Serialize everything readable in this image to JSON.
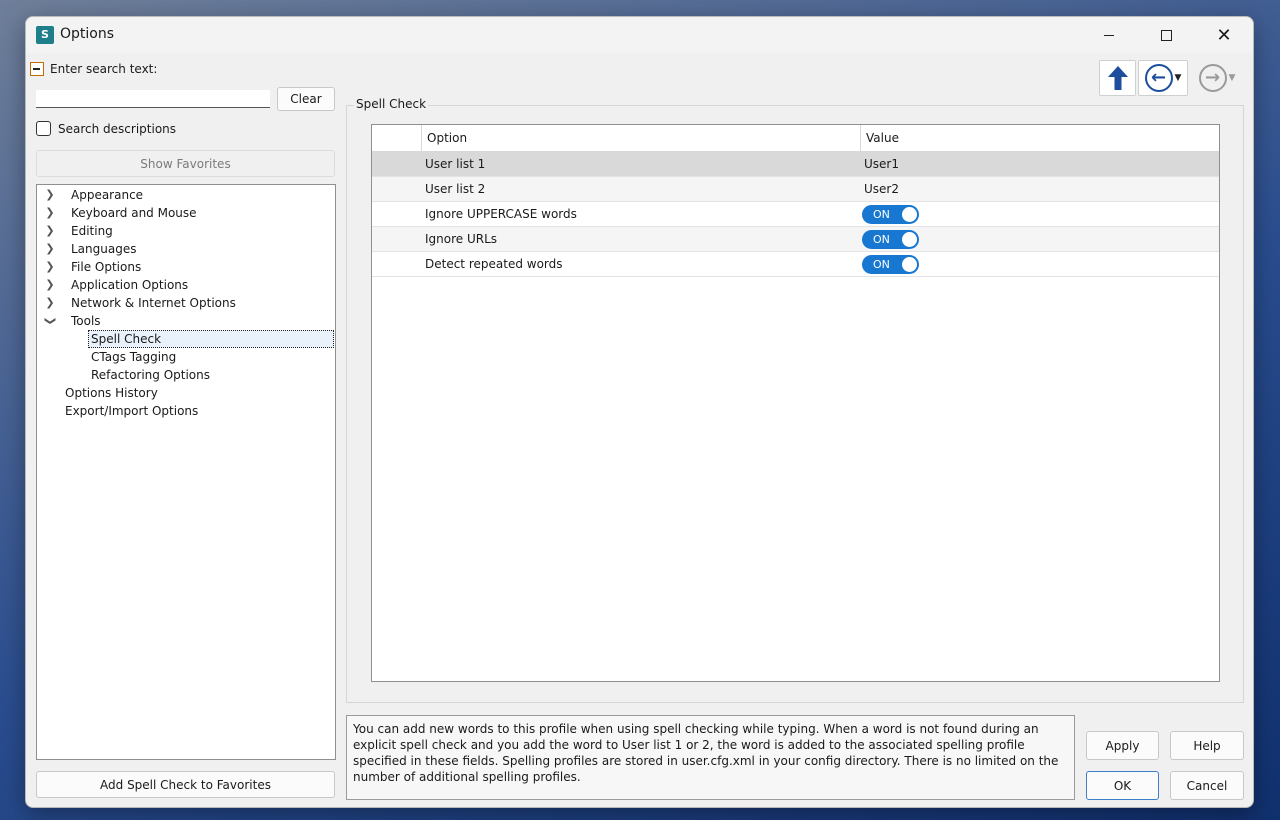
{
  "window": {
    "title": "Options",
    "icon_text": "S"
  },
  "search": {
    "label": "Enter search text:",
    "value": "",
    "clear_label": "Clear",
    "descriptions_label": "Search descriptions"
  },
  "favorites": {
    "show_label": "Show Favorites",
    "add_label": "Add Spell Check to Favorites"
  },
  "tree": {
    "items": [
      {
        "label": "Appearance",
        "state": "collapsed"
      },
      {
        "label": "Keyboard and Mouse",
        "state": "collapsed"
      },
      {
        "label": "Editing",
        "state": "collapsed"
      },
      {
        "label": "Languages",
        "state": "collapsed"
      },
      {
        "label": "File Options",
        "state": "collapsed"
      },
      {
        "label": "Application Options",
        "state": "collapsed"
      },
      {
        "label": "Network & Internet Options",
        "state": "collapsed"
      },
      {
        "label": "Tools",
        "state": "expanded"
      },
      {
        "label": "Spell Check",
        "state": "selected"
      },
      {
        "label": "CTags Tagging",
        "state": "child"
      },
      {
        "label": "Refactoring Options",
        "state": "child"
      },
      {
        "label": "Options History",
        "state": "leaf"
      },
      {
        "label": "Export/Import Options",
        "state": "leaf"
      }
    ]
  },
  "panel": {
    "group_title": "Spell Check",
    "columns": {
      "option": "Option",
      "value": "Value"
    },
    "rows": [
      {
        "option": "User list 1",
        "value": "User1"
      },
      {
        "option": "User list 2",
        "value": "User2"
      },
      {
        "option": "Ignore UPPERCASE words",
        "value": "ON"
      },
      {
        "option": "Ignore URLs",
        "value": "ON"
      },
      {
        "option": "Detect repeated words",
        "value": "ON"
      }
    ]
  },
  "description": "You can add new words to this profile when using spell checking while typing. When a word is not found during an explicit spell check and you add the word to User list 1 or 2, the word is added to the associated spelling profile specified in these fields. Spelling profiles are stored in user.cfg.xml in your config directory. There is no limited on the number of additional spelling profiles.",
  "buttons": {
    "apply": "Apply",
    "help": "Help",
    "ok": "OK",
    "cancel": "Cancel"
  },
  "icons": {
    "up": "arrow-up-icon",
    "back": "arrow-left-circle-icon",
    "forward": "arrow-right-circle-icon"
  },
  "colors": {
    "accent": "#1777d1",
    "nav": "#1d4e9e"
  }
}
